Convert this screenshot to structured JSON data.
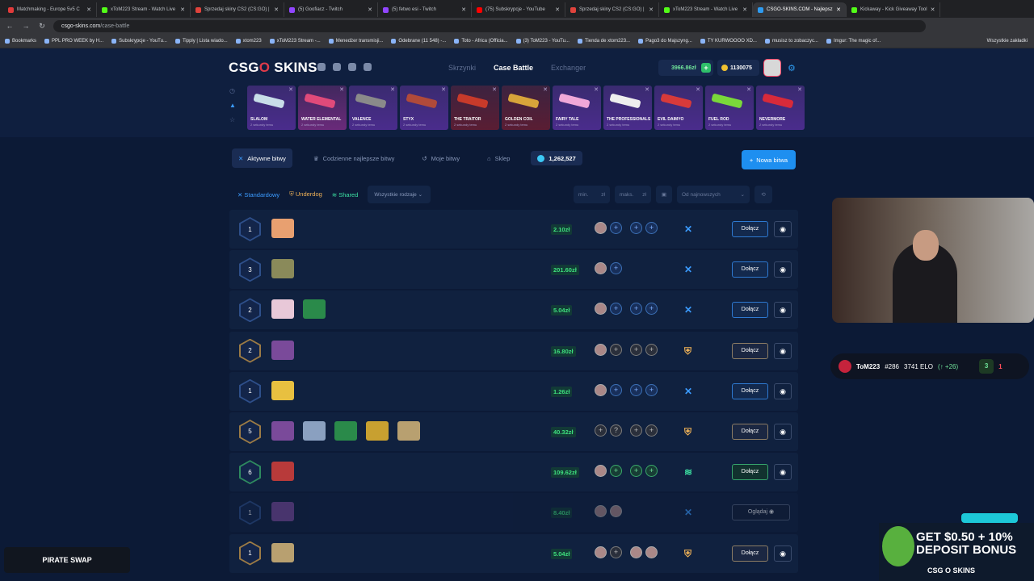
{
  "browser": {
    "tabs": [
      {
        "label": "Matchmaking - Europe 5v5 C",
        "color": "#e23b3b",
        "active": false
      },
      {
        "label": "xToM223 Stream - Watch Live",
        "color": "#53fc18",
        "active": false
      },
      {
        "label": "Sprzedaj skiny CS2 (CS:GO) |",
        "color": "#e0433c",
        "active": false
      },
      {
        "label": "(5) Goofiacz - Twitch",
        "color": "#9146ff",
        "active": false
      },
      {
        "label": "(5) fetwo esi - Twitch",
        "color": "#9146ff",
        "active": false
      },
      {
        "label": "(75) Subskrypcje - YouTube",
        "color": "#ff0000",
        "active": false
      },
      {
        "label": "Sprzedaj skiny CS2 (CS:GO) |",
        "color": "#e0433c",
        "active": false
      },
      {
        "label": "xToM223 Stream - Watch Live",
        "color": "#53fc18",
        "active": false
      },
      {
        "label": "CSGO-SKINS.COM - Najlepsz",
        "color": "#2e9bf0",
        "active": true
      },
      {
        "label": "Kickaway - Kick Giveaway Tool",
        "color": "#53fc18",
        "active": false
      }
    ],
    "url_host": "csgo-skins.com",
    "url_path": "/case-battle",
    "bookmarks": [
      "Bookmarks",
      "PPL PRO WEEK by H...",
      "Subskrypcje - YouTu...",
      "Tipply | Lista wiado...",
      "xtom223",
      "xToM223 Stream -...",
      "Menedżer transmisji...",
      "Odebrane (11 548) -...",
      "Toto - Africa (Officia...",
      "(3) ToM223 - YouTu...",
      "Tienda de xtom223...",
      "Pago3 do Majszyng...",
      "TY KURWOOOO XD...",
      "musisz to zobaczyc...",
      "Imgur: The magic of..."
    ],
    "bookmarks_right": "Wszystkie zakładki"
  },
  "site": {
    "logo_a": "CSG",
    "logo_b": "O",
    "logo_c": " SKINS",
    "nav": [
      "Skrzynki",
      "Case Battle",
      "Exchanger"
    ],
    "balance": "3966.86zł",
    "coins": "1130075",
    "drops": [
      {
        "name": "SLALOM",
        "sub": "2 sekundy temu",
        "gun": "#c8dde8",
        "bg": "purple"
      },
      {
        "name": "WATER ELEMENTAL",
        "sub": "2 sekundy temu",
        "gun": "#e04a7a",
        "bg": "pink"
      },
      {
        "name": "VALENCE",
        "sub": "2 sekundy temu",
        "gun": "#8a8a8a",
        "bg": "purple"
      },
      {
        "name": "STYX",
        "sub": "2 sekundy temu",
        "gun": "#b04a3a",
        "bg": "purple"
      },
      {
        "name": "THE TRAITOR",
        "sub": "2 sekundy temu",
        "gun": "#c83a2a",
        "bg": "red"
      },
      {
        "name": "GOLDEN COIL",
        "sub": "2 sekundy temu",
        "gun": "#d8a43a",
        "bg": "red"
      },
      {
        "name": "FAIRY TALE",
        "sub": "2 sekundy temu",
        "gun": "#f0a8d8",
        "bg": "purple"
      },
      {
        "name": "THE PROFESSIONALS",
        "sub": "2 sekundy temu",
        "gun": "#eeeeee",
        "bg": "purple"
      },
      {
        "name": "EVIL DAIMYO",
        "sub": "2 sekundy temu",
        "gun": "#d83a3a",
        "bg": "purple"
      },
      {
        "name": "FUEL ROD",
        "sub": "2 sekundy temu",
        "gun": "#7ad83a",
        "bg": "purple"
      },
      {
        "name": "NEVERMORE",
        "sub": "2 sekundy temu",
        "gun": "#d82a3a",
        "bg": "purple"
      }
    ],
    "tabs": [
      "Aktywne bitwy",
      "Codzienne najlepsze bitwy",
      "Moje bitwy",
      "Sklep"
    ],
    "gems": "1,262,527",
    "new_battle": "Nowa bitwa",
    "types": [
      "Standardowy",
      "Underdog",
      "Shared"
    ],
    "kinds": "Wszystkie rodzaje",
    "min": "min.",
    "max": "maks.",
    "currency": "zł",
    "sort": "Od najnowszych",
    "join": "Dołącz",
    "watch": "Oglądaj",
    "battles": [
      {
        "rounds": "1",
        "hex": "blue",
        "cases": [
          "#e8a070"
        ],
        "price": "2.10zł",
        "p1": [
          "av",
          "+"
        ],
        "p2": [
          "+",
          "+"
        ],
        "mode": "✕",
        "modeColor": "#3b9bff",
        "btn": "join",
        "btnStyle": ""
      },
      {
        "rounds": "3",
        "hex": "blue",
        "cases": [
          "#8a8a5a"
        ],
        "price": "201.60zł",
        "p1": [
          "av",
          "+"
        ],
        "p2": [],
        "mode": "✕",
        "modeColor": "#3b9bff",
        "btn": "join",
        "btnStyle": ""
      },
      {
        "rounds": "2",
        "hex": "blue",
        "cases": [
          "#e8c8d8",
          "#2a8a4a"
        ],
        "price": "5.04zł",
        "p1": [
          "av",
          "+"
        ],
        "p2": [
          "+",
          "+"
        ],
        "mode": "✕",
        "modeColor": "#3b9bff",
        "btn": "join",
        "btnStyle": ""
      },
      {
        "rounds": "2",
        "hex": "gold",
        "cases": [
          "#7a4a9a"
        ],
        "price": "16.80zł",
        "p1": [
          "av",
          "+"
        ],
        "p2": [
          "+",
          "+"
        ],
        "mode": "⛨",
        "modeColor": "#f0b257",
        "btn": "join",
        "btnStyle": "gold"
      },
      {
        "rounds": "1",
        "hex": "blue",
        "cases": [
          "#e8c040"
        ],
        "price": "1.26zł",
        "p1": [
          "av",
          "+"
        ],
        "p2": [
          "+",
          "+"
        ],
        "mode": "✕",
        "modeColor": "#3b9bff",
        "btn": "join",
        "btnStyle": ""
      },
      {
        "rounds": "5",
        "hex": "gold",
        "cases": [
          "#7a4a9a",
          "#8aa0c0",
          "#2a8a4a",
          "#c8a030",
          "#b8a070"
        ],
        "price": "40.32zł",
        "p1": [
          "+",
          "?"
        ],
        "p2": [
          "+",
          "+"
        ],
        "mode": "⛨",
        "modeColor": "#f0b257",
        "btn": "join",
        "btnStyle": "gold"
      },
      {
        "rounds": "6",
        "hex": "green",
        "cases": [
          "#b83a3a"
        ],
        "price": "109.62zł",
        "p1": [
          "av",
          "+"
        ],
        "p2": [
          "+",
          "+"
        ],
        "mode": "≋",
        "modeColor": "#3ce0a2",
        "btn": "join",
        "btnStyle": "green"
      },
      {
        "rounds": "1",
        "hex": "blue",
        "cases": [
          "#7a4a9a"
        ],
        "price": "8.40zł",
        "p1": [
          "av",
          "av"
        ],
        "p2": [],
        "mode": "✕",
        "modeColor": "#3b9bff",
        "btn": "watch",
        "btnStyle": "view",
        "dim": true
      },
      {
        "rounds": "1",
        "hex": "gold",
        "cases": [
          "#b8a070"
        ],
        "price": "5.04zł",
        "p1": [
          "av",
          "+"
        ],
        "p2": [
          "av",
          "av"
        ],
        "mode": "⛨",
        "modeColor": "#f0b257",
        "btn": "join",
        "btnStyle": "gold"
      }
    ]
  },
  "overlay": {
    "player": "ToM223",
    "rank": "#286",
    "elo": "3741 ELO",
    "delta": "(↑ +26)",
    "score_w": "3",
    "score_l": "1",
    "ad_line1": "GET $0.50 + 10%",
    "ad_line2": "DEPOSIT BONUS",
    "ad_brand": "CSG O SKINS",
    "pirate": "PIRATE SWAP"
  }
}
